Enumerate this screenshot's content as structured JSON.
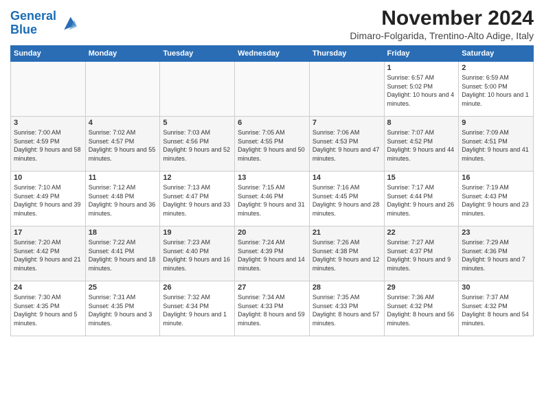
{
  "logo": {
    "line1": "General",
    "line2": "Blue"
  },
  "title": "November 2024",
  "subtitle": "Dimaro-Folgarida, Trentino-Alto Adige, Italy",
  "days_of_week": [
    "Sunday",
    "Monday",
    "Tuesday",
    "Wednesday",
    "Thursday",
    "Friday",
    "Saturday"
  ],
  "weeks": [
    [
      {
        "day": "",
        "info": ""
      },
      {
        "day": "",
        "info": ""
      },
      {
        "day": "",
        "info": ""
      },
      {
        "day": "",
        "info": ""
      },
      {
        "day": "",
        "info": ""
      },
      {
        "day": "1",
        "info": "Sunrise: 6:57 AM\nSunset: 5:02 PM\nDaylight: 10 hours and 4 minutes."
      },
      {
        "day": "2",
        "info": "Sunrise: 6:59 AM\nSunset: 5:00 PM\nDaylight: 10 hours and 1 minute."
      }
    ],
    [
      {
        "day": "3",
        "info": "Sunrise: 7:00 AM\nSunset: 4:59 PM\nDaylight: 9 hours and 58 minutes."
      },
      {
        "day": "4",
        "info": "Sunrise: 7:02 AM\nSunset: 4:57 PM\nDaylight: 9 hours and 55 minutes."
      },
      {
        "day": "5",
        "info": "Sunrise: 7:03 AM\nSunset: 4:56 PM\nDaylight: 9 hours and 52 minutes."
      },
      {
        "day": "6",
        "info": "Sunrise: 7:05 AM\nSunset: 4:55 PM\nDaylight: 9 hours and 50 minutes."
      },
      {
        "day": "7",
        "info": "Sunrise: 7:06 AM\nSunset: 4:53 PM\nDaylight: 9 hours and 47 minutes."
      },
      {
        "day": "8",
        "info": "Sunrise: 7:07 AM\nSunset: 4:52 PM\nDaylight: 9 hours and 44 minutes."
      },
      {
        "day": "9",
        "info": "Sunrise: 7:09 AM\nSunset: 4:51 PM\nDaylight: 9 hours and 41 minutes."
      }
    ],
    [
      {
        "day": "10",
        "info": "Sunrise: 7:10 AM\nSunset: 4:49 PM\nDaylight: 9 hours and 39 minutes."
      },
      {
        "day": "11",
        "info": "Sunrise: 7:12 AM\nSunset: 4:48 PM\nDaylight: 9 hours and 36 minutes."
      },
      {
        "day": "12",
        "info": "Sunrise: 7:13 AM\nSunset: 4:47 PM\nDaylight: 9 hours and 33 minutes."
      },
      {
        "day": "13",
        "info": "Sunrise: 7:15 AM\nSunset: 4:46 PM\nDaylight: 9 hours and 31 minutes."
      },
      {
        "day": "14",
        "info": "Sunrise: 7:16 AM\nSunset: 4:45 PM\nDaylight: 9 hours and 28 minutes."
      },
      {
        "day": "15",
        "info": "Sunrise: 7:17 AM\nSunset: 4:44 PM\nDaylight: 9 hours and 26 minutes."
      },
      {
        "day": "16",
        "info": "Sunrise: 7:19 AM\nSunset: 4:43 PM\nDaylight: 9 hours and 23 minutes."
      }
    ],
    [
      {
        "day": "17",
        "info": "Sunrise: 7:20 AM\nSunset: 4:42 PM\nDaylight: 9 hours and 21 minutes."
      },
      {
        "day": "18",
        "info": "Sunrise: 7:22 AM\nSunset: 4:41 PM\nDaylight: 9 hours and 18 minutes."
      },
      {
        "day": "19",
        "info": "Sunrise: 7:23 AM\nSunset: 4:40 PM\nDaylight: 9 hours and 16 minutes."
      },
      {
        "day": "20",
        "info": "Sunrise: 7:24 AM\nSunset: 4:39 PM\nDaylight: 9 hours and 14 minutes."
      },
      {
        "day": "21",
        "info": "Sunrise: 7:26 AM\nSunset: 4:38 PM\nDaylight: 9 hours and 12 minutes."
      },
      {
        "day": "22",
        "info": "Sunrise: 7:27 AM\nSunset: 4:37 PM\nDaylight: 9 hours and 9 minutes."
      },
      {
        "day": "23",
        "info": "Sunrise: 7:29 AM\nSunset: 4:36 PM\nDaylight: 9 hours and 7 minutes."
      }
    ],
    [
      {
        "day": "24",
        "info": "Sunrise: 7:30 AM\nSunset: 4:35 PM\nDaylight: 9 hours and 5 minutes."
      },
      {
        "day": "25",
        "info": "Sunrise: 7:31 AM\nSunset: 4:35 PM\nDaylight: 9 hours and 3 minutes."
      },
      {
        "day": "26",
        "info": "Sunrise: 7:32 AM\nSunset: 4:34 PM\nDaylight: 9 hours and 1 minute."
      },
      {
        "day": "27",
        "info": "Sunrise: 7:34 AM\nSunset: 4:33 PM\nDaylight: 8 hours and 59 minutes."
      },
      {
        "day": "28",
        "info": "Sunrise: 7:35 AM\nSunset: 4:33 PM\nDaylight: 8 hours and 57 minutes."
      },
      {
        "day": "29",
        "info": "Sunrise: 7:36 AM\nSunset: 4:32 PM\nDaylight: 8 hours and 56 minutes."
      },
      {
        "day": "30",
        "info": "Sunrise: 7:37 AM\nSunset: 4:32 PM\nDaylight: 8 hours and 54 minutes."
      }
    ]
  ]
}
